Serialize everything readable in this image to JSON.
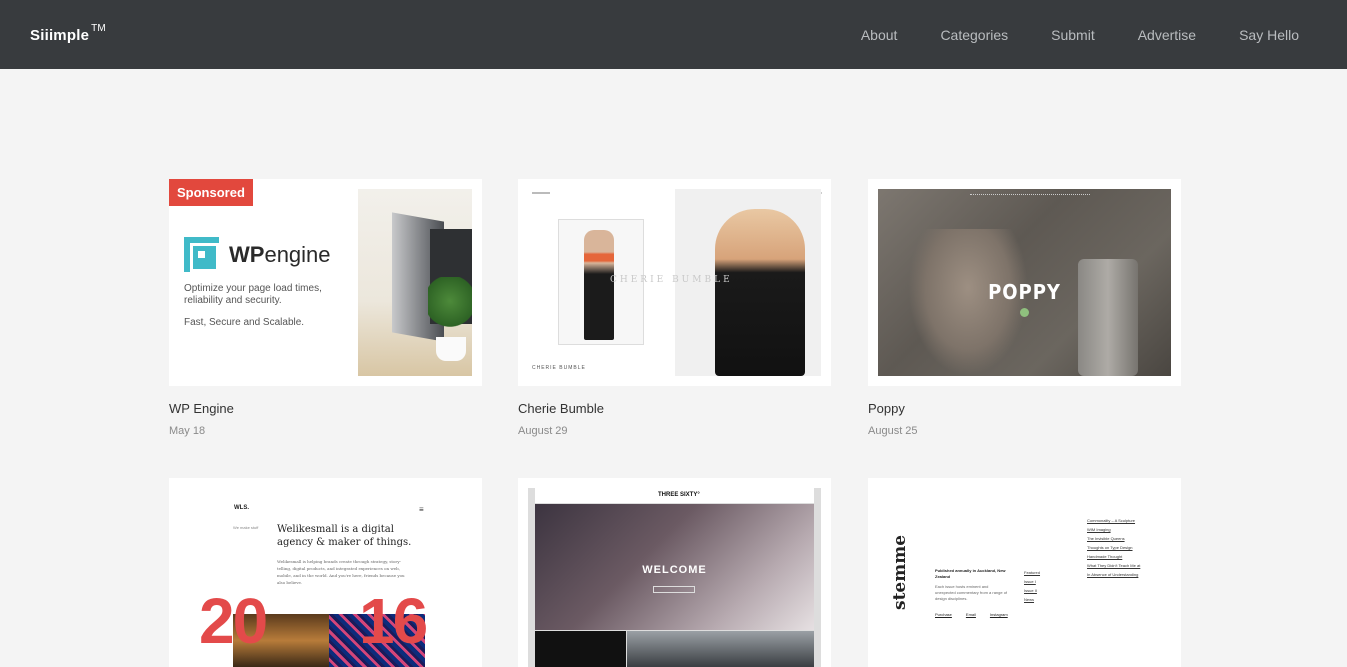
{
  "header": {
    "logo": "Siiimple",
    "logo_mark": "TM",
    "nav": [
      "About",
      "Categories",
      "Submit",
      "Advertise",
      "Say Hello"
    ]
  },
  "cards": [
    {
      "title": "WP Engine",
      "date": "May 18",
      "badge": "Sponsored",
      "ad": {
        "brand_bold": "WP",
        "brand_light": "engine",
        "line1": "Optimize your page load times,",
        "line2": "reliability and security.",
        "line3": "Fast, Secure and Scalable."
      }
    },
    {
      "title": "Cherie Bumble",
      "date": "August 29",
      "preview": {
        "watermark": "CHERIE BUMBLE",
        "caption": "CHERIE BUMBLE"
      }
    },
    {
      "title": "Poppy",
      "date": "August 25",
      "preview": {
        "heading": "POPPY"
      }
    },
    {
      "preview": {
        "brand": "WLS.",
        "menu": "≡",
        "side": "We make stuff",
        "headline": "Welikesmall is a digital agency & maker of things.",
        "body": "Welikesmall is helping brands create through strategy, story-telling, digital products, and integrated experiences on web, mobile, and in the world. And you're here, friends because you also believe.",
        "num_left": "20",
        "num_right": "16"
      }
    },
    {
      "preview": {
        "logo": "THREE SIXTY°",
        "hero": "WELCOME"
      }
    },
    {
      "preview": {
        "brand": "stemme",
        "pub_title": "Published annually in Auckland, New Zealand",
        "pub_body": "Each issue hosts eminent and unexpected commentary from a range of design disciplines.",
        "links": [
          "Featured",
          "Issue I",
          "Issue II",
          "News"
        ],
        "footer_links": [
          "Purchase",
          "Email",
          "Instagram"
        ],
        "articles": [
          "Commonality – A Sculpture",
          "WIM Imaging",
          "The Invisible Queens",
          "Thoughts on Type Design",
          "Handmade Thought",
          "What They Didn't Teach Me at",
          "In Absence of Understanding"
        ]
      }
    }
  ]
}
